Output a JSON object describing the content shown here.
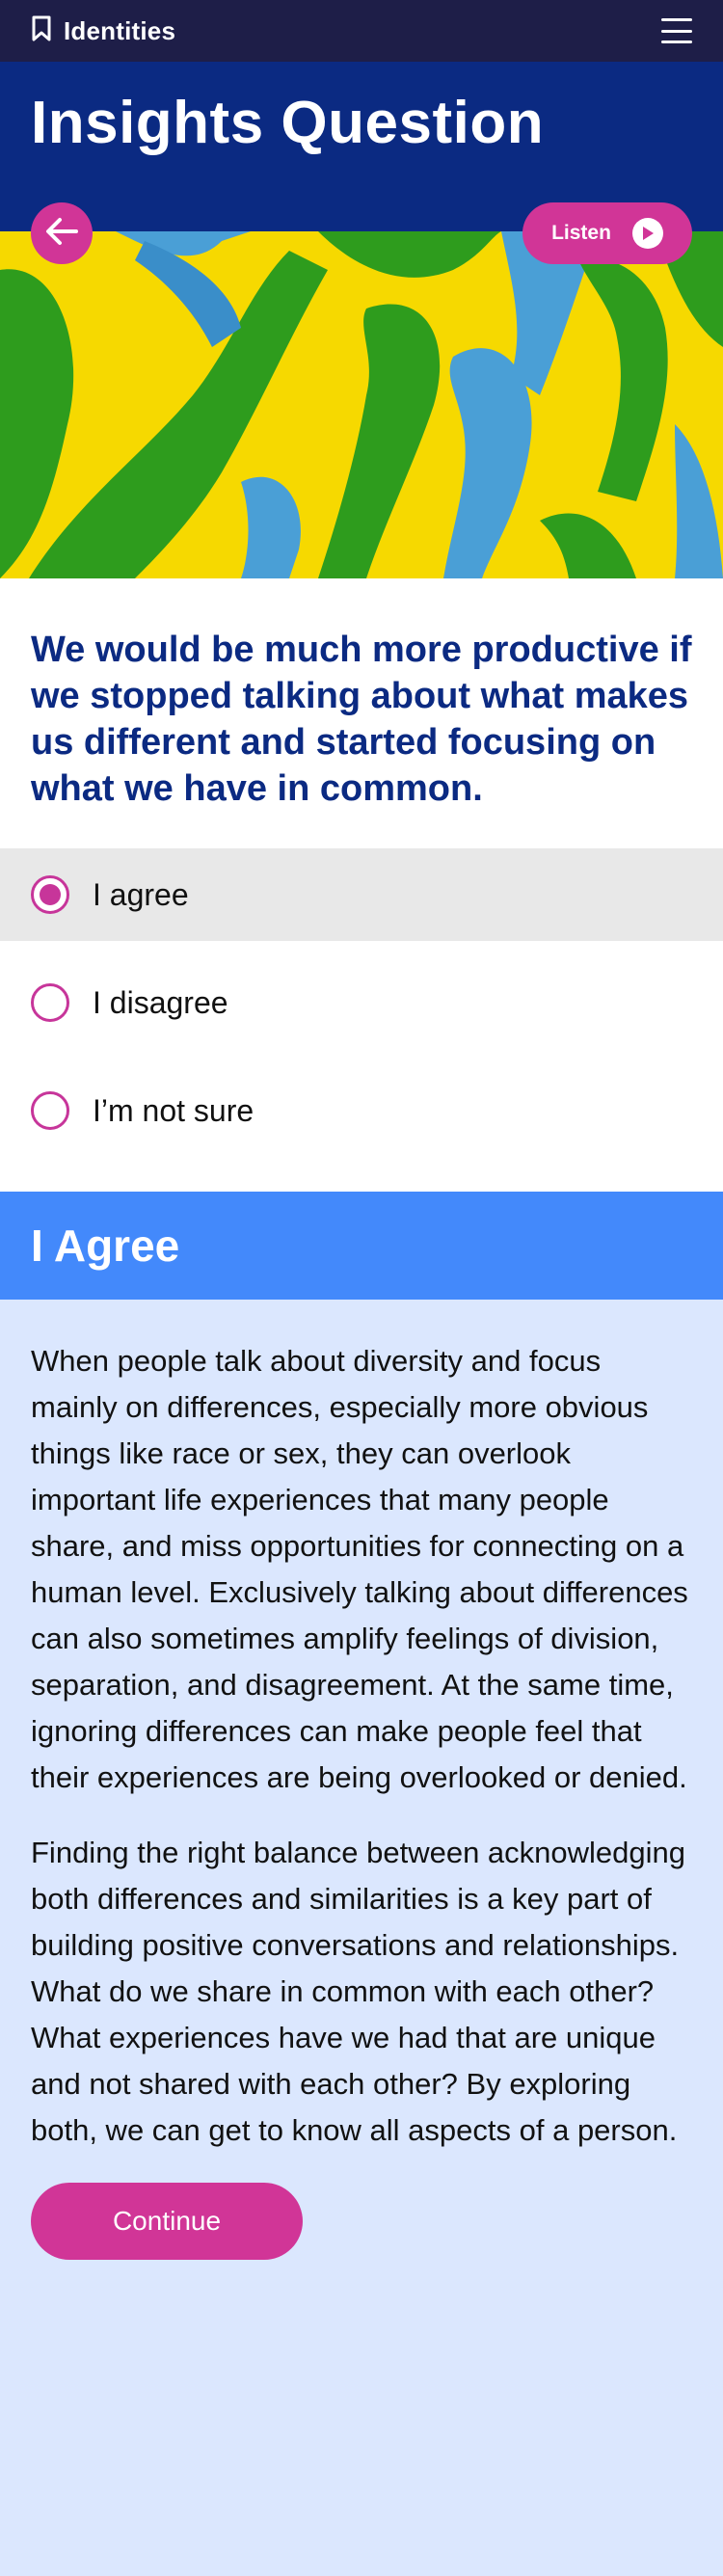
{
  "topbar": {
    "brand_label": "Identities",
    "brand_icon": "bookmark-icon",
    "menu_icon": "hamburger-menu-icon"
  },
  "header": {
    "title": "Insights Question",
    "back_icon": "arrow-left-icon",
    "listen_label": "Listen",
    "listen_icon": "play-icon"
  },
  "hero": {
    "image": "abstract paint art",
    "colors": [
      "#f6d900",
      "#2e9c1d",
      "#4a9fd6"
    ]
  },
  "question": {
    "text": "We would be much more productive if we stopped talking about what makes us different and started focusing on what we have in common."
  },
  "options": [
    {
      "label": "I agree",
      "selected": true
    },
    {
      "label": "I disagree",
      "selected": false
    },
    {
      "label": "I’m not sure",
      "selected": false
    }
  ],
  "answer": {
    "title": "I Agree",
    "paragraphs": [
      "When people talk about diversity and focus mainly on differences, especially more obvious things like race or sex, they can overlook important life experiences that many people share, and miss opportunities for connecting on a human level. Exclusively talking about differences can also sometimes amplify feelings of division, separation, and disagreement. At the same time, ignoring differences can make people feel that their experiences are being overlooked or denied.",
      "Finding the right balance between acknowledging both differences and similarities is a key part of building positive conversations and relationships. What do we share in common with each other? What experiences have we had that are unique and not shared with each other? By exploring both, we can get to know all aspects of a person."
    ],
    "continue_label": "Continue"
  },
  "colors": {
    "topbar_bg": "#1e1e48",
    "title_bg": "#0b2a82",
    "accent_pink": "#d13597",
    "answer_header_bg": "#4389fb",
    "answer_body_bg": "#dbe7fe"
  }
}
